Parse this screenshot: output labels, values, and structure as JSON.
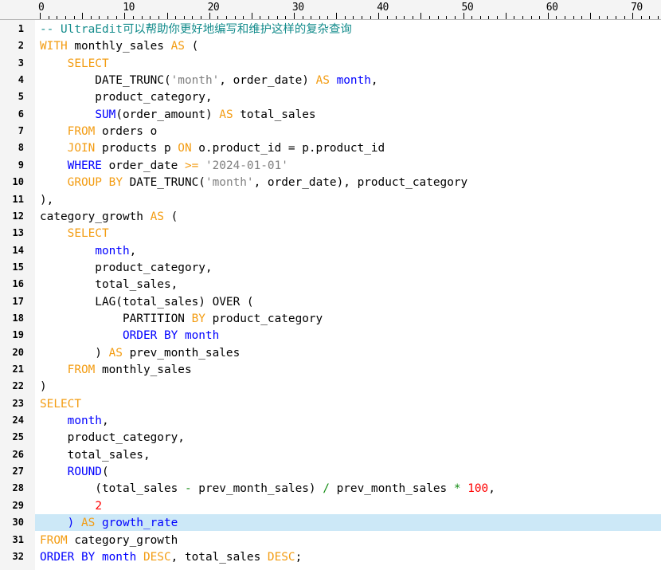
{
  "ruler": {
    "labels": [
      "0",
      "10",
      "20",
      "30",
      "40",
      "50",
      "60",
      "70"
    ]
  },
  "colors": {
    "keyword": "#f39c12",
    "function": "#0000ff",
    "string": "#808080",
    "number": "#ff0000",
    "comment": "#148c8c",
    "operator": "#148c14",
    "current_line_highlight": "#cce8f7"
  },
  "editor": {
    "current_line": 30,
    "lines": [
      {
        "n": "1",
        "tokens": [
          {
            "t": "-- UltraEdit可以帮助你更好地编写和维护这样的复杂查询",
            "c": "cm"
          }
        ]
      },
      {
        "n": "2",
        "tokens": [
          {
            "t": "WITH",
            "c": "kw"
          },
          {
            "t": " monthly_sales ",
            "c": "plain"
          },
          {
            "t": "AS",
            "c": "kw"
          },
          {
            "t": " (",
            "c": "plain"
          }
        ]
      },
      {
        "n": "3",
        "tokens": [
          {
            "t": "    ",
            "c": "plain"
          },
          {
            "t": "SELECT",
            "c": "kw"
          }
        ]
      },
      {
        "n": "4",
        "tokens": [
          {
            "t": "        DATE_TRUNC(",
            "c": "plain"
          },
          {
            "t": "'month'",
            "c": "str"
          },
          {
            "t": ", order_date) ",
            "c": "plain"
          },
          {
            "t": "AS",
            "c": "kw"
          },
          {
            "t": " ",
            "c": "plain"
          },
          {
            "t": "month",
            "c": "fn"
          },
          {
            "t": ",",
            "c": "plain"
          }
        ]
      },
      {
        "n": "5",
        "tokens": [
          {
            "t": "        product_category,",
            "c": "plain"
          }
        ]
      },
      {
        "n": "6",
        "tokens": [
          {
            "t": "        ",
            "c": "plain"
          },
          {
            "t": "SUM",
            "c": "fn"
          },
          {
            "t": "(order_amount) ",
            "c": "plain"
          },
          {
            "t": "AS",
            "c": "kw"
          },
          {
            "t": " total_sales",
            "c": "plain"
          }
        ]
      },
      {
        "n": "7",
        "tokens": [
          {
            "t": "    ",
            "c": "plain"
          },
          {
            "t": "FROM",
            "c": "kw"
          },
          {
            "t": " orders o",
            "c": "plain"
          }
        ]
      },
      {
        "n": "8",
        "tokens": [
          {
            "t": "    ",
            "c": "plain"
          },
          {
            "t": "JOIN",
            "c": "kw"
          },
          {
            "t": " products p ",
            "c": "plain"
          },
          {
            "t": "ON",
            "c": "kw"
          },
          {
            "t": " o.product_id = p.product_id",
            "c": "plain"
          }
        ]
      },
      {
        "n": "9",
        "tokens": [
          {
            "t": "    ",
            "c": "plain"
          },
          {
            "t": "WHERE",
            "c": "fn"
          },
          {
            "t": " order_date ",
            "c": "plain"
          },
          {
            "t": ">=",
            "c": "kw"
          },
          {
            "t": " ",
            "c": "plain"
          },
          {
            "t": "'2024-01-01'",
            "c": "str"
          }
        ]
      },
      {
        "n": "10",
        "tokens": [
          {
            "t": "    ",
            "c": "plain"
          },
          {
            "t": "GROUP",
            "c": "kw"
          },
          {
            "t": " ",
            "c": "plain"
          },
          {
            "t": "BY",
            "c": "kw"
          },
          {
            "t": " DATE_TRUNC(",
            "c": "plain"
          },
          {
            "t": "'month'",
            "c": "str"
          },
          {
            "t": ", order_date), product_category",
            "c": "plain"
          }
        ]
      },
      {
        "n": "11",
        "tokens": [
          {
            "t": "),",
            "c": "plain"
          }
        ]
      },
      {
        "n": "12",
        "tokens": [
          {
            "t": "category_growth ",
            "c": "plain"
          },
          {
            "t": "AS",
            "c": "kw"
          },
          {
            "t": " (",
            "c": "plain"
          }
        ]
      },
      {
        "n": "13",
        "tokens": [
          {
            "t": "    ",
            "c": "plain"
          },
          {
            "t": "SELECT",
            "c": "kw"
          }
        ]
      },
      {
        "n": "14",
        "tokens": [
          {
            "t": "        ",
            "c": "plain"
          },
          {
            "t": "month",
            "c": "fn"
          },
          {
            "t": ",",
            "c": "plain"
          }
        ]
      },
      {
        "n": "15",
        "tokens": [
          {
            "t": "        product_category,",
            "c": "plain"
          }
        ]
      },
      {
        "n": "16",
        "tokens": [
          {
            "t": "        total_sales,",
            "c": "plain"
          }
        ]
      },
      {
        "n": "17",
        "tokens": [
          {
            "t": "        LAG(total_sales) OVER (",
            "c": "plain"
          }
        ]
      },
      {
        "n": "18",
        "tokens": [
          {
            "t": "            PARTITION ",
            "c": "plain"
          },
          {
            "t": "BY",
            "c": "kw"
          },
          {
            "t": " product_category",
            "c": "plain"
          }
        ]
      },
      {
        "n": "19",
        "tokens": [
          {
            "t": "            ",
            "c": "plain"
          },
          {
            "t": "ORDER BY month",
            "c": "fn"
          }
        ]
      },
      {
        "n": "20",
        "tokens": [
          {
            "t": "        ) ",
            "c": "plain"
          },
          {
            "t": "AS",
            "c": "kw"
          },
          {
            "t": " prev_month_sales",
            "c": "plain"
          }
        ]
      },
      {
        "n": "21",
        "tokens": [
          {
            "t": "    ",
            "c": "plain"
          },
          {
            "t": "FROM",
            "c": "kw"
          },
          {
            "t": " monthly_sales",
            "c": "plain"
          }
        ]
      },
      {
        "n": "22",
        "tokens": [
          {
            "t": ")",
            "c": "plain"
          }
        ]
      },
      {
        "n": "23",
        "tokens": [
          {
            "t": "SELECT",
            "c": "kw"
          }
        ]
      },
      {
        "n": "24",
        "tokens": [
          {
            "t": "    ",
            "c": "plain"
          },
          {
            "t": "month",
            "c": "fn"
          },
          {
            "t": ",",
            "c": "plain"
          }
        ]
      },
      {
        "n": "25",
        "tokens": [
          {
            "t": "    product_category,",
            "c": "plain"
          }
        ]
      },
      {
        "n": "26",
        "tokens": [
          {
            "t": "    total_sales,",
            "c": "plain"
          }
        ]
      },
      {
        "n": "27",
        "tokens": [
          {
            "t": "    ",
            "c": "plain"
          },
          {
            "t": "ROUND",
            "c": "fn"
          },
          {
            "t": "(",
            "c": "plain"
          }
        ]
      },
      {
        "n": "28",
        "tokens": [
          {
            "t": "        (total_sales ",
            "c": "plain"
          },
          {
            "t": "-",
            "c": "op"
          },
          {
            "t": " prev_month_sales) ",
            "c": "plain"
          },
          {
            "t": "/",
            "c": "op"
          },
          {
            "t": " prev_month_sales ",
            "c": "plain"
          },
          {
            "t": "*",
            "c": "op"
          },
          {
            "t": " ",
            "c": "plain"
          },
          {
            "t": "100",
            "c": "num"
          },
          {
            "t": ",",
            "c": "plain"
          }
        ]
      },
      {
        "n": "29",
        "tokens": [
          {
            "t": "        ",
            "c": "plain"
          },
          {
            "t": "2",
            "c": "num"
          }
        ]
      },
      {
        "n": "30",
        "tokens": [
          {
            "t": "    ) ",
            "c": "fn"
          },
          {
            "t": "AS",
            "c": "kw"
          },
          {
            "t": " ",
            "c": "plain"
          },
          {
            "t": "growth_rate",
            "c": "fn"
          }
        ]
      },
      {
        "n": "31",
        "tokens": [
          {
            "t": "FROM",
            "c": "kw"
          },
          {
            "t": " category_growth",
            "c": "plain"
          }
        ]
      },
      {
        "n": "32",
        "tokens": [
          {
            "t": "ORDER BY month",
            "c": "fn"
          },
          {
            "t": " ",
            "c": "plain"
          },
          {
            "t": "DESC",
            "c": "kw"
          },
          {
            "t": ", total_sales ",
            "c": "plain"
          },
          {
            "t": "DESC",
            "c": "kw"
          },
          {
            "t": ";",
            "c": "plain"
          }
        ]
      }
    ]
  }
}
